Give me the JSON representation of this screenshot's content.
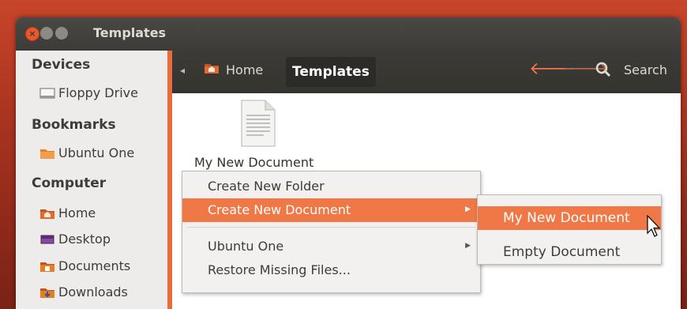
{
  "window": {
    "title": "Templates",
    "controls": [
      "close-icon",
      "minimize-icon",
      "maximize-icon"
    ]
  },
  "sidebar": {
    "sections": [
      {
        "heading": "Devices",
        "items": [
          {
            "label": "Floppy Drive",
            "icon": "floppy-drive-icon"
          }
        ]
      },
      {
        "heading": "Bookmarks",
        "items": [
          {
            "label": "Ubuntu One",
            "icon": "folder-icon"
          }
        ]
      },
      {
        "heading": "Computer",
        "items": [
          {
            "label": "Home",
            "icon": "home-folder-icon"
          },
          {
            "label": "Desktop",
            "icon": "desktop-icon"
          },
          {
            "label": "Documents",
            "icon": "documents-folder-icon"
          },
          {
            "label": "Downloads",
            "icon": "downloads-folder-icon"
          }
        ]
      }
    ]
  },
  "toolbar": {
    "breadcrumbs": [
      {
        "label": "Home",
        "icon": "home-folder-icon"
      },
      {
        "label": "Templates",
        "active": true
      }
    ],
    "search_label": "Search"
  },
  "content": {
    "files": [
      {
        "name": "My New Document",
        "icon": "text-document-icon"
      }
    ]
  },
  "context_menu": {
    "items": [
      {
        "label": "Create New Folder",
        "submenu": false
      },
      {
        "label": "Create New Document",
        "submenu": true,
        "highlighted": true
      },
      {
        "label": "Ubuntu One",
        "submenu": true
      },
      {
        "label": "Restore Missing Files...",
        "submenu": false
      }
    ]
  },
  "submenu": {
    "items": [
      {
        "label": "My New Document",
        "highlighted": true
      },
      {
        "label": "Empty Document"
      }
    ]
  },
  "colors": {
    "accent": "#f07746",
    "titlebar": "#3c3b37",
    "sidebar_bg": "#edecea",
    "sidebar_border": "#e96d3c",
    "desktop_bg": "#b23a22"
  }
}
